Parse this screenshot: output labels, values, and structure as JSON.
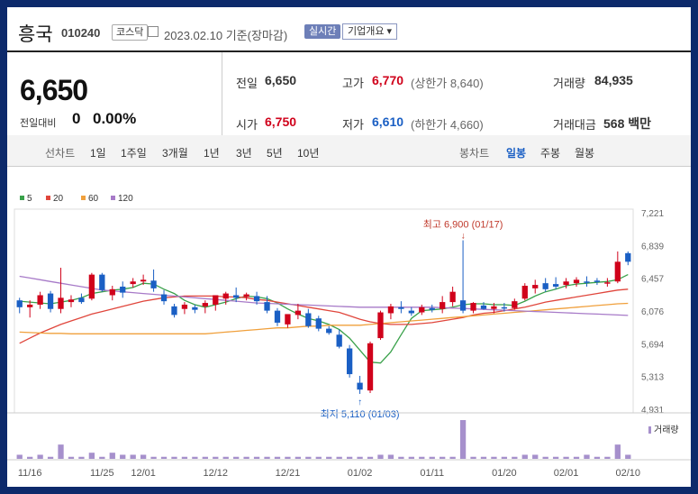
{
  "header": {
    "name": "흥국",
    "code": "010240",
    "market": "코스닥",
    "date": "2023.02.10",
    "basis": "기준(장마감)",
    "realtime": "실시간",
    "overview": "기업개요 ▾"
  },
  "summary": {
    "price": "6,650",
    "change_label": "전일대비",
    "change_value": "0",
    "change_pct": "0.00%",
    "prev_label": "전일",
    "prev_value": "6,650",
    "high_label": "고가",
    "high_value": "6,770",
    "upper_limit": "(상한가 8,640)",
    "volume_label": "거래량",
    "volume_value": "84,935",
    "open_label": "시가",
    "open_value": "6,750",
    "low_label": "저가",
    "low_value": "6,610",
    "lower_limit": "(하한가 4,660)",
    "amount_label": "거래대금",
    "amount_value": "568 백만"
  },
  "period_bar": {
    "line_label": "선차트",
    "line_options": [
      "1일",
      "1주일",
      "3개월",
      "1년",
      "3년",
      "5년",
      "10년"
    ],
    "candle_label": "봉차트",
    "candle_options": [
      "일봉",
      "주봉",
      "월봉"
    ],
    "selected_candle": "일봉"
  },
  "colors": {
    "up": "#d0021b",
    "down": "#1a5fc4",
    "ma5": "#39a14a",
    "ma20": "#e0463c",
    "ma60": "#f0a03c",
    "ma120": "#a77ac8",
    "volume": "#a690cc"
  },
  "chart_data": {
    "type": "candlestick",
    "legend": [
      "5",
      "20",
      "60",
      "120"
    ],
    "y_ticks": [
      "7,221",
      "6,839",
      "6,457",
      "6,076",
      "5,694",
      "5,313",
      "4,931"
    ],
    "ylim": [
      4931,
      7221
    ],
    "x_ticks": [
      {
        "label": "11/16",
        "index": 1
      },
      {
        "label": "11/25",
        "index": 8
      },
      {
        "label": "12/01",
        "index": 12
      },
      {
        "label": "12/12",
        "index": 19
      },
      {
        "label": "12/21",
        "index": 26
      },
      {
        "label": "01/02",
        "index": 33
      },
      {
        "label": "01/11",
        "index": 40
      },
      {
        "label": "01/20",
        "index": 47
      },
      {
        "label": "02/01",
        "index": 53
      },
      {
        "label": "02/10",
        "index": 59
      }
    ],
    "max_label": "최고 6,900 (01/17)",
    "min_label": "최저 5,110 (01/03)",
    "max_index": 43,
    "min_index": 33,
    "volume_label": "거래량",
    "candles": [
      {
        "o": 6200,
        "h": 6230,
        "l": 6050,
        "c": 6120
      },
      {
        "o": 6120,
        "h": 6200,
        "l": 6000,
        "c": 6150
      },
      {
        "o": 6150,
        "h": 6300,
        "l": 6100,
        "c": 6260
      },
      {
        "o": 6280,
        "h": 6310,
        "l": 6060,
        "c": 6100
      },
      {
        "o": 6100,
        "h": 6580,
        "l": 6050,
        "c": 6230
      },
      {
        "o": 6180,
        "h": 6260,
        "l": 6120,
        "c": 6210
      },
      {
        "o": 6230,
        "h": 6280,
        "l": 6160,
        "c": 6180
      },
      {
        "o": 6220,
        "h": 6520,
        "l": 6200,
        "c": 6500
      },
      {
        "o": 6500,
        "h": 6520,
        "l": 6300,
        "c": 6320
      },
      {
        "o": 6260,
        "h": 6370,
        "l": 6200,
        "c": 6330
      },
      {
        "o": 6360,
        "h": 6420,
        "l": 6230,
        "c": 6290
      },
      {
        "o": 6390,
        "h": 6460,
        "l": 6350,
        "c": 6420
      },
      {
        "o": 6420,
        "h": 6500,
        "l": 6380,
        "c": 6440
      },
      {
        "o": 6430,
        "h": 6560,
        "l": 6300,
        "c": 6340
      },
      {
        "o": 6270,
        "h": 6320,
        "l": 6150,
        "c": 6190
      },
      {
        "o": 6130,
        "h": 6160,
        "l": 6000,
        "c": 6030
      },
      {
        "o": 6100,
        "h": 6180,
        "l": 6040,
        "c": 6150
      },
      {
        "o": 6120,
        "h": 6150,
        "l": 6050,
        "c": 6090
      },
      {
        "o": 6130,
        "h": 6200,
        "l": 6050,
        "c": 6170
      },
      {
        "o": 6150,
        "h": 6210,
        "l": 6080,
        "c": 6260
      },
      {
        "o": 6220,
        "h": 6300,
        "l": 6150,
        "c": 6280
      },
      {
        "o": 6260,
        "h": 6350,
        "l": 6180,
        "c": 6230
      },
      {
        "o": 6240,
        "h": 6290,
        "l": 6200,
        "c": 6270
      },
      {
        "o": 6250,
        "h": 6300,
        "l": 6150,
        "c": 6190
      },
      {
        "o": 6180,
        "h": 6250,
        "l": 6050,
        "c": 6080
      },
      {
        "o": 6080,
        "h": 6110,
        "l": 5900,
        "c": 5940
      },
      {
        "o": 5920,
        "h": 5980,
        "l": 5880,
        "c": 6040
      },
      {
        "o": 6030,
        "h": 6160,
        "l": 5980,
        "c": 6080
      },
      {
        "o": 6050,
        "h": 6100,
        "l": 5880,
        "c": 5900
      },
      {
        "o": 5990,
        "h": 6020,
        "l": 5840,
        "c": 5870
      },
      {
        "o": 5870,
        "h": 5900,
        "l": 5800,
        "c": 5820
      },
      {
        "o": 5800,
        "h": 5860,
        "l": 5640,
        "c": 5660
      },
      {
        "o": 5640,
        "h": 5680,
        "l": 5300,
        "c": 5340
      },
      {
        "o": 5240,
        "h": 5320,
        "l": 5110,
        "c": 5160
      },
      {
        "o": 5150,
        "h": 5720,
        "l": 5120,
        "c": 5700
      },
      {
        "o": 5760,
        "h": 6080,
        "l": 5740,
        "c": 6060
      },
      {
        "o": 6050,
        "h": 6160,
        "l": 5980,
        "c": 6130
      },
      {
        "o": 6120,
        "h": 6190,
        "l": 6050,
        "c": 6100
      },
      {
        "o": 6080,
        "h": 6120,
        "l": 6020,
        "c": 6050
      },
      {
        "o": 6060,
        "h": 6150,
        "l": 6030,
        "c": 6120
      },
      {
        "o": 6110,
        "h": 6150,
        "l": 6060,
        "c": 6090
      },
      {
        "o": 6100,
        "h": 6250,
        "l": 6050,
        "c": 6180
      },
      {
        "o": 6180,
        "h": 6360,
        "l": 6130,
        "c": 6300
      },
      {
        "o": 6200,
        "h": 6900,
        "l": 6050,
        "c": 6080
      },
      {
        "o": 6080,
        "h": 6180,
        "l": 6050,
        "c": 6170
      },
      {
        "o": 6140,
        "h": 6180,
        "l": 6090,
        "c": 6100
      },
      {
        "o": 6100,
        "h": 6170,
        "l": 6050,
        "c": 6130
      },
      {
        "o": 6120,
        "h": 6170,
        "l": 6070,
        "c": 6110
      },
      {
        "o": 6110,
        "h": 6220,
        "l": 6090,
        "c": 6190
      },
      {
        "o": 6220,
        "h": 6400,
        "l": 6200,
        "c": 6370
      },
      {
        "o": 6340,
        "h": 6440,
        "l": 6280,
        "c": 6380
      },
      {
        "o": 6400,
        "h": 6460,
        "l": 6300,
        "c": 6330
      },
      {
        "o": 6390,
        "h": 6470,
        "l": 6330,
        "c": 6360
      },
      {
        "o": 6380,
        "h": 6460,
        "l": 6340,
        "c": 6420
      },
      {
        "o": 6400,
        "h": 6470,
        "l": 6360,
        "c": 6440
      },
      {
        "o": 6420,
        "h": 6480,
        "l": 6360,
        "c": 6410
      },
      {
        "o": 6430,
        "h": 6460,
        "l": 6380,
        "c": 6420
      },
      {
        "o": 6400,
        "h": 6460,
        "l": 6360,
        "c": 6410
      },
      {
        "o": 6420,
        "h": 6770,
        "l": 6400,
        "c": 6650
      },
      {
        "o": 6750,
        "h": 6770,
        "l": 6610,
        "c": 6650
      }
    ],
    "volumes": [
      2,
      1,
      2,
      1,
      7,
      1,
      1,
      3,
      1,
      3,
      2,
      2,
      2,
      1,
      1,
      1,
      1,
      1,
      1,
      1,
      1,
      1,
      1,
      1,
      1,
      1,
      1,
      1,
      1,
      1,
      1,
      1,
      1,
      1,
      1,
      2,
      2,
      1,
      1,
      1,
      1,
      1,
      1,
      19,
      1,
      1,
      1,
      1,
      1,
      2,
      2,
      1,
      1,
      1,
      1,
      2,
      1,
      1,
      7,
      2
    ],
    "ma": [
      {
        "name": "5",
        "color": "#39a14a",
        "values": [
          6190,
          6180,
          6170,
          6160,
          6180,
          6200,
          6230,
          6280,
          6300,
          6320,
          6330,
          6350,
          6400,
          6390,
          6330,
          6280,
          6200,
          6150,
          6120,
          6150,
          6180,
          6220,
          6250,
          6240,
          6220,
          6170,
          6100,
          6040,
          5990,
          5960,
          5920,
          5860,
          5760,
          5620,
          5480,
          5470,
          5600,
          5800,
          5990,
          6080,
          6090,
          6100,
          6120,
          6150,
          6160,
          6160,
          6150,
          6150,
          6140,
          6190,
          6250,
          6300,
          6330,
          6370,
          6390,
          6400,
          6410,
          6420,
          6440,
          6500
        ]
      },
      {
        "name": "20",
        "color": "#e0463c",
        "values": [
          5700,
          5760,
          5820,
          5870,
          5920,
          5960,
          6000,
          6040,
          6070,
          6100,
          6130,
          6160,
          6190,
          6210,
          6230,
          6240,
          6250,
          6250,
          6250,
          6250,
          6240,
          6240,
          6230,
          6210,
          6200,
          6180,
          6160,
          6140,
          6120,
          6100,
          6080,
          6060,
          6020,
          5980,
          5950,
          5930,
          5920,
          5920,
          5920,
          5930,
          5940,
          5960,
          5980,
          6000,
          6030,
          6050,
          6060,
          6080,
          6100,
          6120,
          6150,
          6180,
          6200,
          6220,
          6240,
          6260,
          6280,
          6300,
          6320,
          6330
        ]
      },
      {
        "name": "60",
        "color": "#f0a03c",
        "values": [
          5830,
          5825,
          5820,
          5815,
          5815,
          5810,
          5810,
          5810,
          5810,
          5810,
          5810,
          5810,
          5810,
          5810,
          5810,
          5810,
          5810,
          5810,
          5810,
          5820,
          5830,
          5840,
          5850,
          5860,
          5870,
          5880,
          5880,
          5890,
          5900,
          5900,
          5910,
          5910,
          5910,
          5910,
          5920,
          5930,
          5940,
          5950,
          5960,
          5970,
          5980,
          5990,
          6000,
          6010,
          6020,
          6030,
          6040,
          6050,
          6060,
          6070,
          6080,
          6090,
          6100,
          6110,
          6120,
          6130,
          6140,
          6150,
          6160,
          6165
        ]
      },
      {
        "name": "120",
        "color": "#a77ac8",
        "values": [
          6480,
          6460,
          6440,
          6420,
          6400,
          6380,
          6360,
          6340,
          6320,
          6310,
          6300,
          6290,
          6280,
          6270,
          6260,
          6250,
          6240,
          6230,
          6220,
          6210,
          6200,
          6190,
          6180,
          6170,
          6165,
          6160,
          6155,
          6150,
          6145,
          6140,
          6135,
          6130,
          6125,
          6120,
          6120,
          6120,
          6120,
          6120,
          6120,
          6120,
          6120,
          6115,
          6110,
          6105,
          6100,
          6095,
          6090,
          6085,
          6080,
          6075,
          6070,
          6065,
          6060,
          6055,
          6050,
          6045,
          6040,
          6035,
          6030,
          6025
        ]
      }
    ]
  }
}
